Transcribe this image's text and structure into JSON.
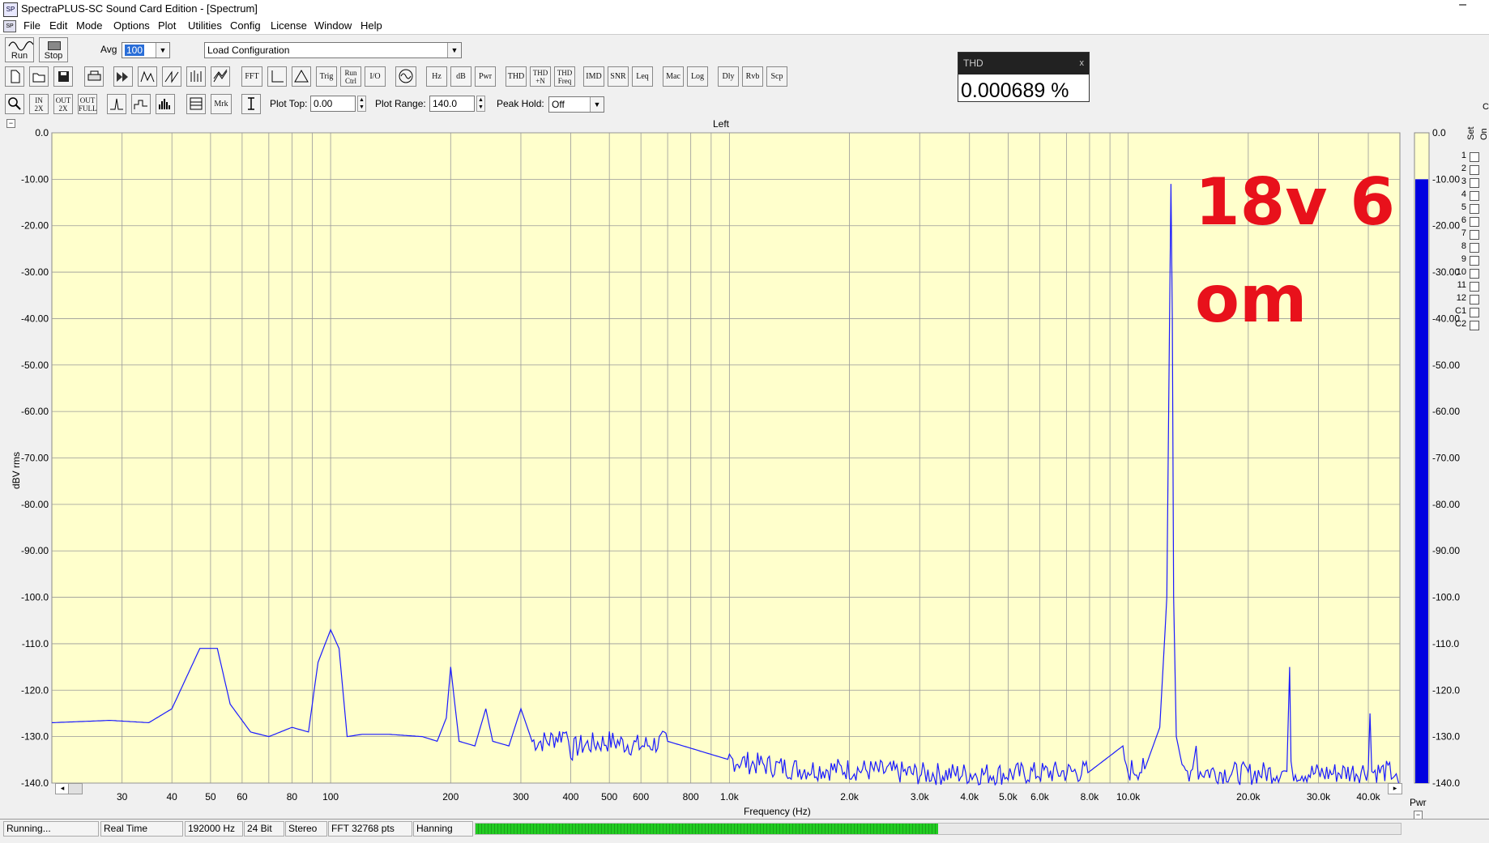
{
  "window": {
    "title": "SpectraPLUS-SC Sound Card Edition - [Spectrum]",
    "minimize_glyph": "–"
  },
  "menu": [
    "File",
    "Edit",
    "Mode",
    "Options",
    "Plot",
    "Utilities",
    "Config",
    "License",
    "Window",
    "Help"
  ],
  "toolbar1": {
    "run_label": "Run",
    "stop_label": "Stop",
    "avg_label": "Avg",
    "avg_value": "100",
    "config_value": "Load Configuration"
  },
  "toolbar2": {
    "buttons": [
      "FFT",
      "Trig",
      "Run Ctrl",
      "I/O",
      "Hz",
      "dB",
      "Pwr",
      "THD",
      "THD +N",
      "THD Freq",
      "IMD",
      "SNR",
      "Leq",
      "Mac",
      "Log",
      "Dly",
      "Rvb",
      "Scp"
    ]
  },
  "toolbar3": {
    "zoom_in": "IN 2X",
    "zoom_out": "OUT 2X",
    "zoom_full": "OUT FULL",
    "mrk": "Mrk",
    "plot_top_label": "Plot Top:",
    "plot_top_value": "0.00",
    "plot_range_label": "Plot Range:",
    "plot_range_value": "140.0",
    "peak_hold_label": "Peak Hold:",
    "peak_hold_value": "Off"
  },
  "thd_window": {
    "title": "THD",
    "close": "x",
    "value": "0.000689 %"
  },
  "annotation": {
    "line1": "18v 6",
    "line2": "om"
  },
  "plot": {
    "channel_label": "Left",
    "collapse_glyph": "−",
    "ylabel": "dBV rms",
    "xlabel": "Frequency (Hz)",
    "power_label": "Pwr",
    "set_label": "Set",
    "on_label": "On",
    "extra_label": "C",
    "set_rows": [
      "1",
      "2",
      "3",
      "4",
      "5",
      "6",
      "7",
      "8",
      "9",
      "10",
      "11",
      "12",
      "C1",
      "C2"
    ],
    "scroll_left": "◂",
    "scroll_right": "▸"
  },
  "chart_data": {
    "type": "line",
    "xlabel": "Frequency (Hz)",
    "ylabel": "dBV rms",
    "x_scale": "log",
    "xlim": [
      20,
      48000
    ],
    "ylim": [
      -140,
      0
    ],
    "grid": true,
    "ytick_labels": [
      "0.0",
      "-10.00",
      "-20.00",
      "-30.00",
      "-40.00",
      "-50.00",
      "-60.00",
      "-70.00",
      "-80.00",
      "-90.00",
      "-100.0",
      "-110.0",
      "-120.0",
      "-130.0",
      "-140.0"
    ],
    "yticks": [
      0,
      -10,
      -20,
      -30,
      -40,
      -50,
      -60,
      -70,
      -80,
      -90,
      -100,
      -110,
      -120,
      -130,
      -140
    ],
    "xtick_labels": [
      "30",
      "40",
      "50",
      "60",
      "80",
      "100",
      "200",
      "300",
      "400",
      "500",
      "600",
      "800",
      "1.0k",
      "2.0k",
      "3.0k",
      "4.0k",
      "5.0k",
      "6.0k",
      "8.0k",
      "10.0k",
      "20.0k",
      "30.0k",
      "40.0k"
    ],
    "xticks": [
      30,
      40,
      50,
      60,
      80,
      100,
      200,
      300,
      400,
      500,
      600,
      800,
      1000,
      2000,
      3000,
      4000,
      5000,
      6000,
      8000,
      10000,
      20000,
      30000,
      40000
    ],
    "series": [
      {
        "color": "#1a1aff",
        "x": [
          20,
          28,
          35,
          40,
          47,
          52,
          56,
          63,
          70,
          80,
          88,
          93,
          100,
          105,
          110,
          120,
          140,
          170,
          185,
          195,
          200,
          210,
          230,
          245,
          255,
          280,
          300,
          320,
          350,
          390,
          400,
          420,
          500,
          600,
          700,
          1000,
          1200,
          1500,
          2000,
          3000,
          5000,
          8000,
          9700,
          9900,
          10200,
          11000,
          12000,
          12500,
          12700,
          12800,
          12900,
          13000,
          13200,
          13800,
          14500,
          14800,
          15000,
          16000,
          20000,
          25000,
          25400,
          25600,
          26000,
          30000,
          38000,
          40000,
          40400,
          40800,
          44000,
          47000,
          48000
        ],
        "y": [
          -127,
          -126.5,
          -127,
          -124,
          -111,
          -111,
          -123,
          -129,
          -130,
          -128,
          -129,
          -114,
          -107,
          -111,
          -130,
          -129.5,
          -129.5,
          -130,
          -131,
          -126,
          -115,
          -131,
          -132,
          -124,
          -131,
          -132,
          -124,
          -131,
          -131,
          -129,
          -133,
          -132,
          -131,
          -132,
          -131,
          -135,
          -136,
          -137,
          -137,
          -138,
          -138,
          -137.5,
          -132,
          -138,
          -137,
          -137,
          -128,
          -100,
          -40,
          -11,
          -40,
          -100,
          -130,
          -138,
          -137,
          -132,
          -137.5,
          -137.5,
          -138,
          -137.5,
          -115,
          -137.5,
          -137.5,
          -138,
          -137.5,
          -137,
          -125,
          -137.5,
          -137.5,
          -138,
          -141
        ]
      }
    ],
    "power_meter_dbv": -10
  },
  "statusbar": {
    "state": "Running...",
    "mode": "Real Time",
    "rate": "192000 Hz",
    "bits": "24 Bit",
    "channels": "Stereo",
    "fft": "FFT 32768 pts",
    "window": "Hanning",
    "level_fraction": 0.5
  },
  "colors": {
    "plot_bg": "#ffffcc",
    "trace": "#1a1aff",
    "power_bar": "#0000e0",
    "annotation": "#e8111b",
    "level_meter": "#22cc22"
  }
}
